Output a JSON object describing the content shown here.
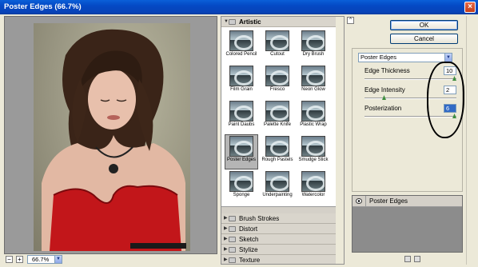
{
  "window": {
    "title": "Poster Edges (66.7%)",
    "close_glyph": "×"
  },
  "preview": {
    "zoom": "66.7%",
    "zoom_out": "−",
    "zoom_in": "+",
    "dropdown_glyph": "▼"
  },
  "gallery": {
    "artistic_label": "Artistic",
    "open_glyph": "▼",
    "closed_glyph": "▶",
    "thumbnails": [
      "Colored Pencil",
      "Cutout",
      "Dry Brush",
      "Film Grain",
      "Fresco",
      "Neon Glow",
      "Paint Daubs",
      "Palette Knife",
      "Plastic Wrap",
      "Poster Edges",
      "Rough Pastels",
      "Smudge Stick",
      "Sponge",
      "Underpainting",
      "Watercolor"
    ],
    "selected": "Poster Edges",
    "other_categories": [
      "Brush Strokes",
      "Distort",
      "Sketch",
      "Stylize",
      "Texture"
    ]
  },
  "buttons": {
    "ok": "OK",
    "cancel": "Cancel",
    "collapse": "^"
  },
  "settings": {
    "filter_select": "Poster Edges",
    "dropdown_glyph": "▼",
    "params": [
      {
        "label": "Edge Thickness",
        "value": "10",
        "level": 1.0
      },
      {
        "label": "Edge Intensity",
        "value": "2",
        "level": 0.2
      },
      {
        "label": "Posterization",
        "value": "6",
        "level": 1.0
      }
    ]
  },
  "layers": {
    "item": "Poster Edges"
  },
  "colors": {
    "titlebar": "#0449c4",
    "selection": "#316ac5",
    "slider_thumb": "#3f8e3f"
  }
}
